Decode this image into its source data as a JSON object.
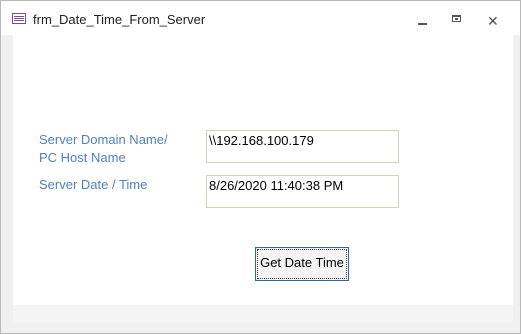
{
  "window": {
    "title": "frm_Date_Time_From_Server",
    "icons": {
      "app": "access-form-icon",
      "minimize": "minimize-icon",
      "maximize": "maximize-icon",
      "close": "close-icon"
    },
    "close_glyph": "✕"
  },
  "form": {
    "server_name_label": "Server Domain Name/ PC Host Name",
    "server_name_value": "\\\\192.168.100.179",
    "server_date_label": "Server Date / Time",
    "server_date_value": "8/26/2020 11:40:38 PM",
    "get_button_label": "Get Date Time"
  },
  "colors": {
    "label_text": "#4f81bd",
    "button_border": "#2d63b3"
  }
}
